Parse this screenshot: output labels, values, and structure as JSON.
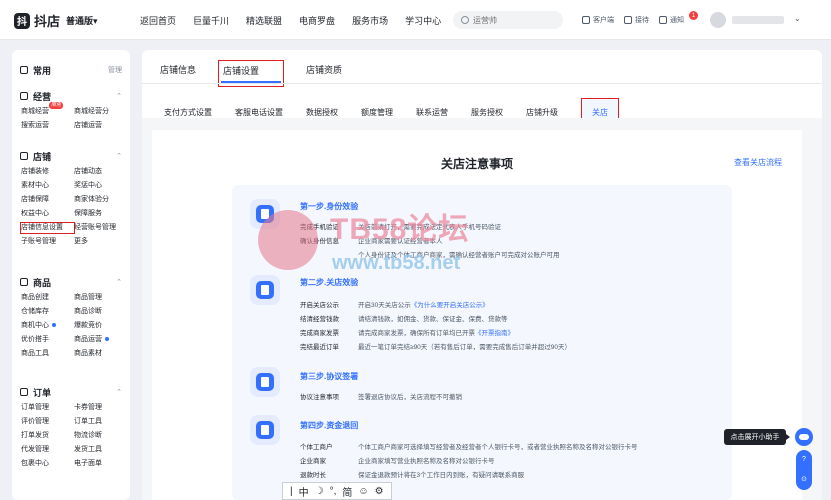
{
  "header": {
    "logo_mark": "抖",
    "logo_text": "抖店",
    "version": "普通版▾",
    "nav": [
      "返回首页",
      "巨量千川",
      "精选联盟",
      "电商罗盘",
      "服务市场",
      "学习中心"
    ],
    "search_placeholder": "运营帅",
    "tools": [
      "客户端",
      "接待",
      "通知"
    ],
    "notify_count": "1"
  },
  "sidebar": {
    "common": {
      "title": "常用",
      "action": "管理"
    },
    "sections": [
      {
        "title": "经营",
        "items": [
          "商城经营",
          "商城经营分",
          "搜索运营",
          "店铺运营"
        ],
        "new_tag": "限免"
      },
      {
        "title": "店铺",
        "items": [
          "店铺装修",
          "店铺动态",
          "素材中心",
          "奖惩中心",
          "店铺保障",
          "商家体验分",
          "权益中心",
          "保障服务",
          "店铺信息设置",
          "经营账号管理",
          "子账号管理",
          "更多"
        ]
      },
      {
        "title": "商品",
        "items": [
          "商品创建",
          "商品管理",
          "仓储库存",
          "商品诊断",
          "商机中心",
          "爆款竞价",
          "优价搭手",
          "商品运营",
          "商品工具",
          "商品素材"
        ]
      },
      {
        "title": "订单",
        "items": [
          "订单管理",
          "卡券管理",
          "评价管理",
          "订单工具",
          "打单发货",
          "物流诊断",
          "代发管理",
          "发货工具",
          "包裹中心",
          "电子面单"
        ]
      }
    ]
  },
  "tabs1": [
    "店铺信息",
    "店铺设置",
    "店铺资质"
  ],
  "tabs2": [
    "支付方式设置",
    "客服电话设置",
    "数据授权",
    "额度管理",
    "联系运营",
    "服务授权",
    "店铺升级",
    "关店"
  ],
  "panel": {
    "title": "关店注意事项",
    "link": "查看关店流程",
    "steps": [
      {
        "title": "第一步.身份效验",
        "rows": [
          {
            "k": "完成手机验证",
            "v": "关店前请打开，需要完成法定代表人手机号码验证"
          },
          {
            "k": "确认身份信息",
            "v": "企业商家需要认证经营者本人"
          },
          {
            "k": "",
            "v": "个人身份证及个体工商户商家，需确认经营者账户可完成对公账户可用"
          }
        ]
      },
      {
        "title": "第二步.关店效验",
        "rows": [
          {
            "k": "开启关店公示",
            "v": "开启30天关店公示",
            "link": "《为什么要开启关店公示》"
          },
          {
            "k": "结清经营钱款",
            "v": "请结清钱款，如佣金、货款、保证金、保费、贷款等"
          },
          {
            "k": "完成商家发票",
            "v": "请完成商家发票，确保所有订单均已开票",
            "link": "《开票指南》"
          },
          {
            "k": "完结最近订单",
            "v": "最近一笔订单完结≥90天（若有售后订单，需要完成售后订单并超过90天）"
          }
        ]
      },
      {
        "title": "第三步.协议签署",
        "rows": [
          {
            "k": "协议注意事项",
            "v": "签署退店协议后，关店流程不可撤销"
          }
        ]
      },
      {
        "title": "第四步.资金退回",
        "rows": [
          {
            "k": "个体工商户",
            "v": "个体工商户商家可选择填写经营者及经营者个人银行卡号，或者营业执照名称及名称对公银行卡号"
          },
          {
            "k": "企业商家",
            "v": "企业商家填写营业执照名称及名称对公银行卡号"
          },
          {
            "k": "退款时长",
            "v": "保证金退款预计将在3个工作日内到账，有疑问请联系商服"
          }
        ]
      }
    ]
  },
  "watermark": {
    "title": "TB58论坛",
    "url": "www.tb58.net"
  },
  "helper": {
    "tip": "点击展开小助手",
    "buttons": [
      "?",
      "⊙"
    ]
  },
  "ime": [
    "中",
    "☽",
    "°,",
    "简",
    "☺",
    "⚙"
  ]
}
